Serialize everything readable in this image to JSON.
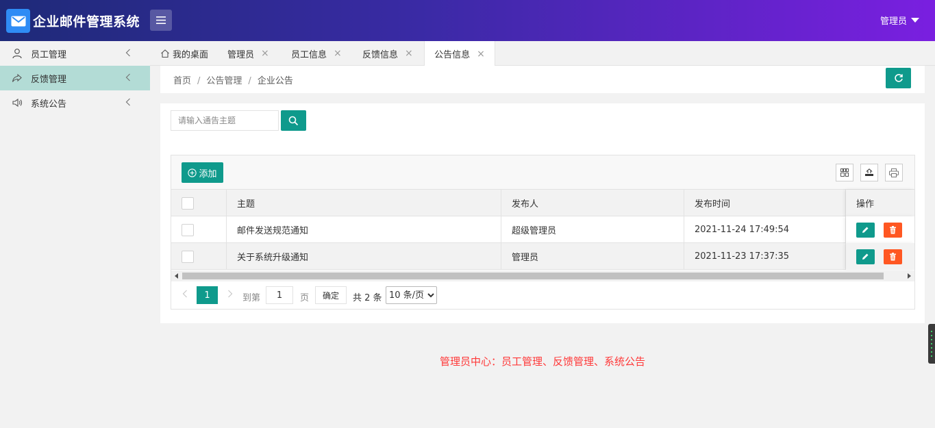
{
  "header": {
    "app_title": "企业邮件管理系统",
    "user_label": "管理员",
    "colors": {
      "gradient_start": "#1e2a78",
      "gradient_end": "#7a1fe0",
      "logo_bg": "#2f8cf5"
    }
  },
  "sidebar": {
    "items": [
      {
        "label": "员工管理",
        "icon": "user-icon",
        "active": false
      },
      {
        "label": "反馈管理",
        "icon": "share-icon",
        "active": true
      },
      {
        "label": "系统公告",
        "icon": "speaker-icon",
        "active": false
      }
    ]
  },
  "tabs": [
    {
      "label": "我的桌面",
      "icon": "home-icon",
      "closable": false,
      "active": false
    },
    {
      "label": "管理员",
      "closable": true,
      "active": false
    },
    {
      "label": "员工信息",
      "closable": true,
      "active": false
    },
    {
      "label": "反馈信息",
      "closable": true,
      "active": false
    },
    {
      "label": "公告信息",
      "closable": true,
      "active": true
    }
  ],
  "tab_close_glyph": "×",
  "breadcrumb": {
    "items": [
      "首页",
      "公告管理",
      "企业公告"
    ],
    "separator": "/"
  },
  "search": {
    "placeholder": "请输入通告主题",
    "value": ""
  },
  "toolbar": {
    "add_label": "添加"
  },
  "table": {
    "columns": [
      "主题",
      "发布人",
      "发布时间",
      "操作"
    ],
    "rows": [
      {
        "subject": "邮件发送规范通知",
        "publisher": "超级管理员",
        "time": "2021-11-24 17:49:54"
      },
      {
        "subject": "关于系统升级通知",
        "publisher": "管理员",
        "time": "2021-11-23 17:37:35"
      }
    ]
  },
  "pager": {
    "current_page": "1",
    "goto_label": "到第",
    "goto_value": "1",
    "page_label": "页",
    "confirm_label": "确定",
    "total_label": "共 2 条",
    "page_size_option": "10 条/页"
  },
  "footer_note": "管理员中心：员工管理、反馈管理、系统公告",
  "colors": {
    "accent": "#0f9a8c",
    "danger": "#ff5722",
    "note": "#ff3838",
    "active_side": "#b3dcd6"
  }
}
